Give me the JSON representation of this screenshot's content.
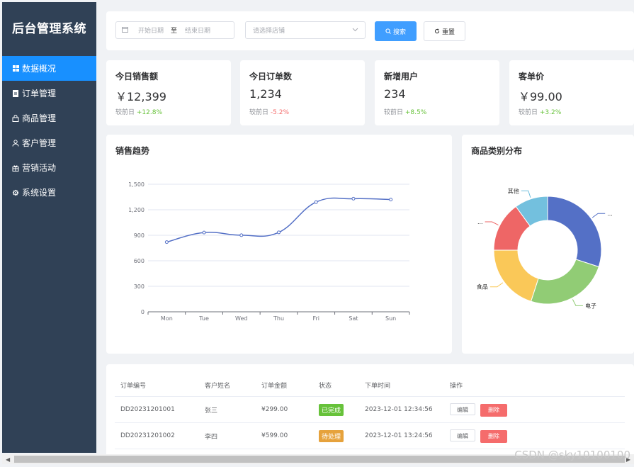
{
  "app": {
    "title": "后台管理系统"
  },
  "sidebar": {
    "items": [
      {
        "label": "数据概况",
        "icon": "grid-icon",
        "active": true
      },
      {
        "label": "订单管理",
        "icon": "document-icon",
        "active": false
      },
      {
        "label": "商品管理",
        "icon": "bag-icon",
        "active": false
      },
      {
        "label": "客户管理",
        "icon": "user-icon",
        "active": false
      },
      {
        "label": "营销活动",
        "icon": "gift-icon",
        "active": false
      },
      {
        "label": "系统设置",
        "icon": "gear-icon",
        "active": false
      }
    ]
  },
  "toolbar": {
    "start_placeholder": "开始日期",
    "range_separator": "至",
    "end_placeholder": "结束日期",
    "shop_placeholder": "请选择店铺",
    "search_label": "搜索",
    "reset_label": "重置"
  },
  "stats": [
    {
      "title": "今日销售额",
      "value": "￥12,399",
      "compare_label": "较前日",
      "change": "+12.8%",
      "trend": "up"
    },
    {
      "title": "今日订单数",
      "value": "1,234",
      "compare_label": "较前日",
      "change": "-5.2%",
      "trend": "down"
    },
    {
      "title": "新增用户",
      "value": "234",
      "compare_label": "较前日",
      "change": "+8.5%",
      "trend": "up"
    },
    {
      "title": "客单价",
      "value": "￥99.00",
      "compare_label": "较前日",
      "change": "+3.2%",
      "trend": "up"
    }
  ],
  "trend_panel": {
    "title": "销售趋势"
  },
  "pie_panel": {
    "title": "商品类别分布"
  },
  "chart_data": [
    {
      "type": "line",
      "title": "销售趋势",
      "categories": [
        "Mon",
        "Tue",
        "Wed",
        "Thu",
        "Fri",
        "Sat",
        "Sun"
      ],
      "series": [
        {
          "values": [
            820,
            932,
            901,
            934,
            1290,
            1330,
            1320
          ]
        }
      ],
      "ylim": [
        0,
        1500
      ],
      "yticks": [
        "0",
        "300",
        "600",
        "900",
        "1,200",
        "1,500"
      ],
      "smooth": true,
      "color": "#5470c6",
      "grid": true
    },
    {
      "type": "pie",
      "title": "商品类别分布",
      "donut": true,
      "slices": [
        {
          "label": "...",
          "value": 30,
          "color": "#5470c6"
        },
        {
          "label": "电子",
          "value": 25,
          "color": "#91cc75"
        },
        {
          "label": "食品",
          "value": 20,
          "color": "#fac858"
        },
        {
          "label": "...",
          "value": 15,
          "color": "#ee6666"
        },
        {
          "label": "其他",
          "value": 10,
          "color": "#73c0de"
        }
      ]
    }
  ],
  "orders": {
    "headers": [
      "订单编号",
      "客户姓名",
      "订单金额",
      "状态",
      "下单时间",
      "操作"
    ],
    "rows": [
      {
        "id": "DD20231201001",
        "customer": "张三",
        "amount": "¥299.00",
        "status": "已完成",
        "status_type": "done",
        "time": "2023-12-01 12:34:56",
        "edit": "编辑",
        "delete": "删除"
      },
      {
        "id": "DD20231201002",
        "customer": "李四",
        "amount": "¥599.00",
        "status": "待处理",
        "status_type": "pending",
        "time": "2023-12-01 13:24:56",
        "edit": "编辑",
        "delete": "删除"
      }
    ]
  },
  "watermark": "CSDN @sky10100100"
}
